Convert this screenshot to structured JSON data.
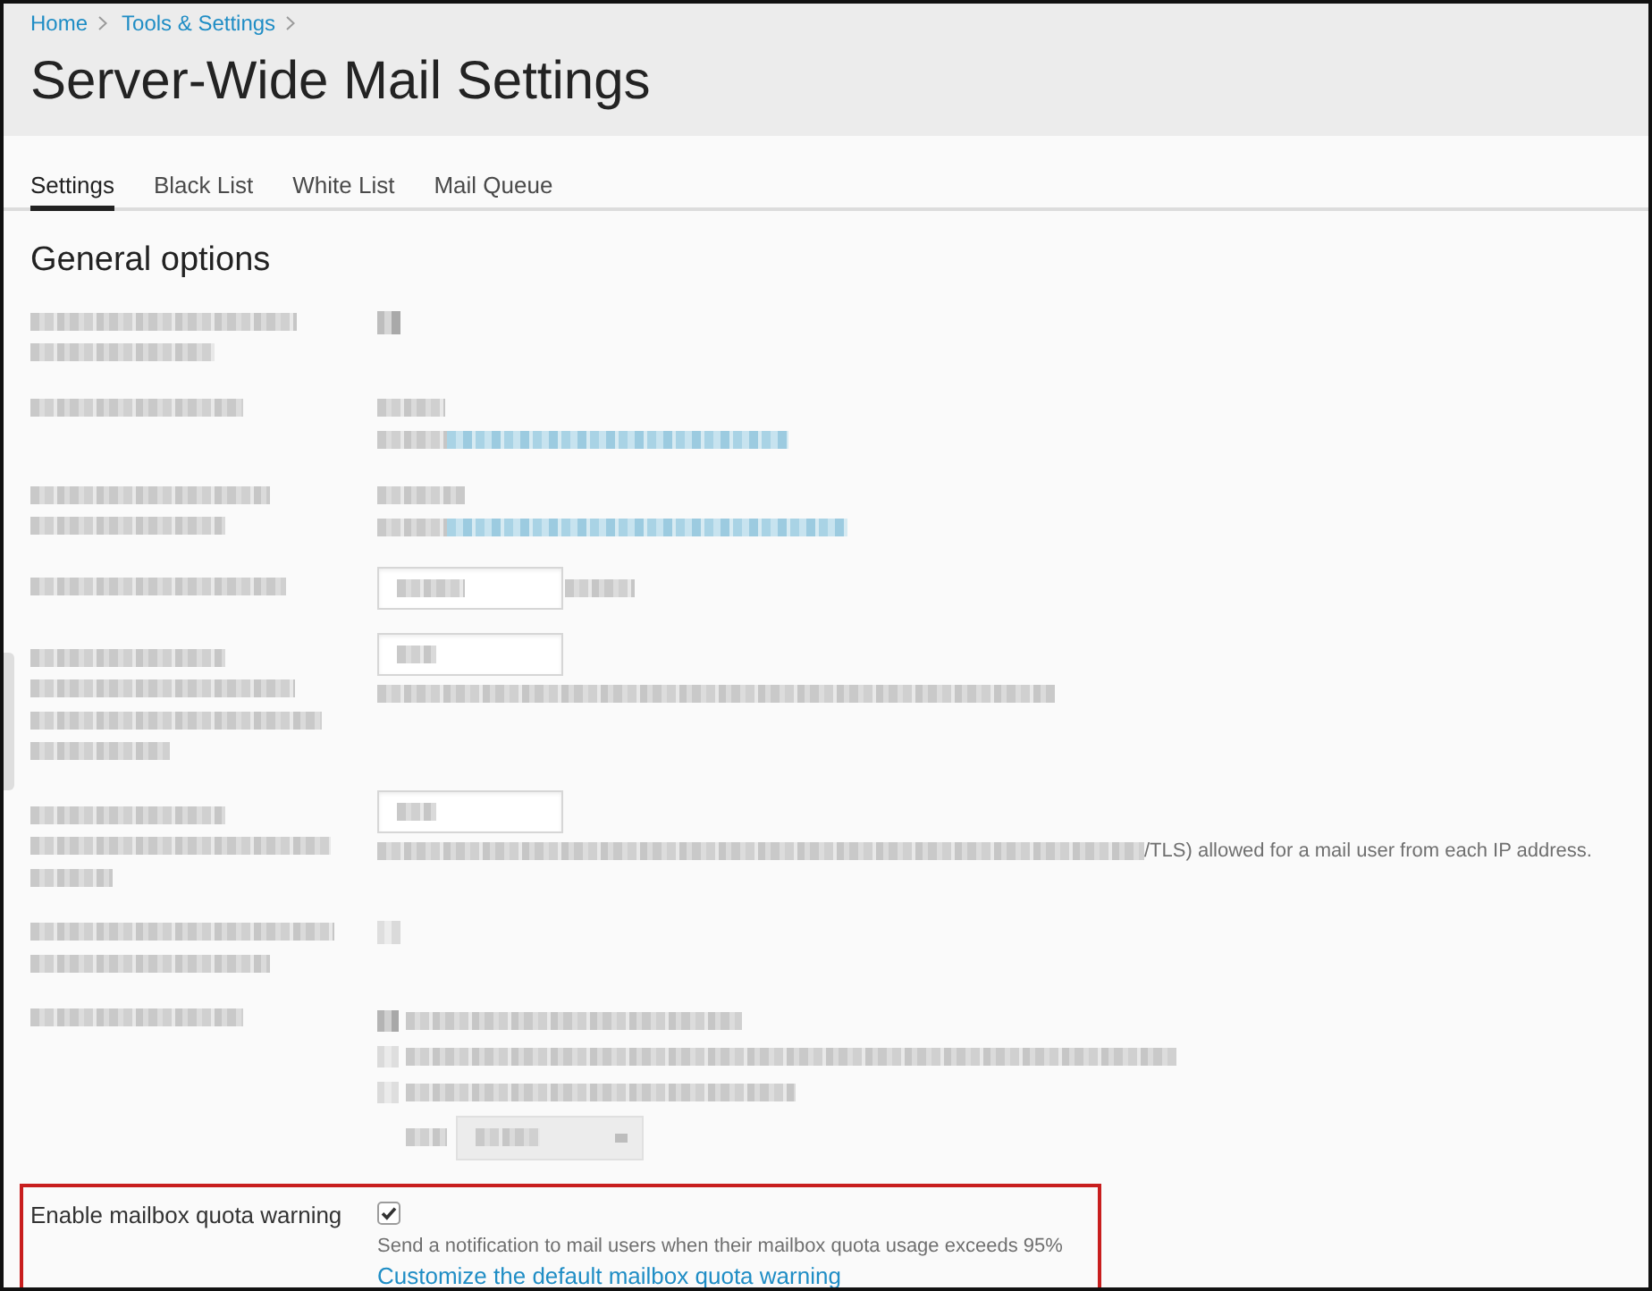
{
  "breadcrumb": [
    {
      "label": "Home"
    },
    {
      "label": "Tools & Settings"
    }
  ],
  "title": "Server-Wide Mail Settings",
  "tabs": [
    {
      "label": "Settings",
      "selected": true
    },
    {
      "label": "Black List",
      "selected": false
    },
    {
      "label": "White List",
      "selected": false
    },
    {
      "label": "Mail Queue",
      "selected": false
    }
  ],
  "section_title": "General options",
  "redacted_rows": [
    {
      "kind": "checkbox",
      "checked": true
    },
    {
      "kind": "value-link"
    },
    {
      "kind": "value-link"
    },
    {
      "kind": "input-unit"
    },
    {
      "kind": "input-hint"
    },
    {
      "kind": "input-hint",
      "hint_tail": "/TLS) allowed for a mail user from each IP address."
    },
    {
      "kind": "checkbox",
      "checked": false
    },
    {
      "kind": "radio-select",
      "radios": [
        {
          "selected": true
        },
        {
          "selected": false
        },
        {
          "selected": false
        }
      ]
    }
  ],
  "quota_warning": {
    "label": "Enable mailbox quota warning",
    "checked": true,
    "hint": "Send a notification to mail users when their mailbox quota usage exceeds 95%",
    "link": "Customize the default mailbox quota warning",
    "highlighted": true
  }
}
